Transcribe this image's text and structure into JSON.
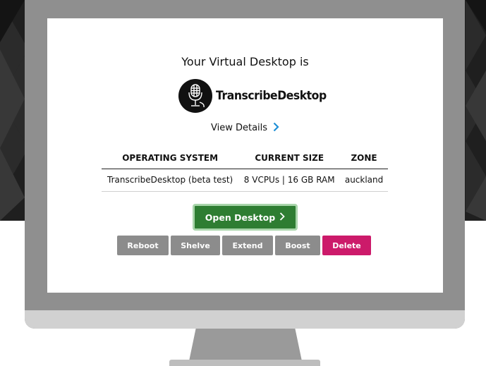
{
  "screen": {
    "heading": "Your Virtual Desktop is",
    "logo": {
      "text": "TranscribeDesktop",
      "icon": "microphone-icon"
    },
    "view_details": {
      "label": "View Details",
      "icon": "chevron-right-icon"
    },
    "table": {
      "headers": [
        "OPERATING SYSTEM",
        "CURRENT SIZE",
        "ZONE"
      ],
      "rows": [
        [
          "TranscribeDesktop (beta test)",
          "8 VCPUs | 16 GB RAM",
          "auckland"
        ]
      ]
    },
    "open_button": {
      "label": "Open Desktop",
      "icon": "chevron-right-icon"
    },
    "actions": {
      "reboot": "Reboot",
      "shelve": "Shelve",
      "extend": "Extend",
      "boost": "Boost",
      "delete": "Delete"
    }
  },
  "colors": {
    "open_button": "#2e7d32",
    "delete_button": "#cc1a6a",
    "action_button": "#8c8c8c",
    "link_chevron": "#1f8fd6"
  }
}
